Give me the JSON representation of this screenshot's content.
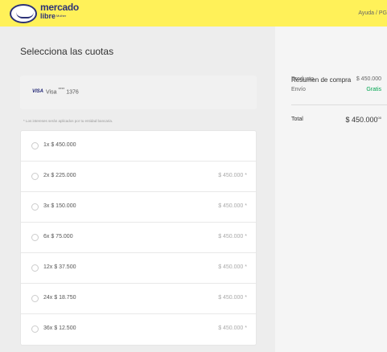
{
  "header": {
    "logo_line1": "mercado",
    "logo_line2": "libre",
    "logo_line3": "Mulher",
    "help_link": "Ayuda / PG"
  },
  "main": {
    "title": "Selecciona las cuotas",
    "card": {
      "brand": "VISA",
      "name": "Visa",
      "mask": "****",
      "last4": "1376"
    },
    "interest_note": "* Los intereses serán aplicados por tu entidad bancaria.",
    "options": [
      {
        "label": "1x $ 450.000",
        "total": ""
      },
      {
        "label": "2x $ 225.000",
        "total": "$ 450.000 *"
      },
      {
        "label": "3x $ 150.000",
        "total": "$ 450.000 *"
      },
      {
        "label": "6x $ 75.000",
        "total": "$ 450.000 *"
      },
      {
        "label": "12x $ 37.500",
        "total": "$ 450.000 *"
      },
      {
        "label": "24x $ 18.750",
        "total": "$ 450.000 *"
      },
      {
        "label": "36x $ 12.500",
        "total": "$ 450.000 *"
      }
    ]
  },
  "summary": {
    "title": "Resumen de compra",
    "product_label": "Producto",
    "product_value": "$ 450.000",
    "shipping_label": "Envío",
    "shipping_value": "Gratis",
    "total_label": "Total",
    "total_value": "$ 450.000",
    "total_cents": "00"
  },
  "colors": {
    "header": "#fff159",
    "brand_blue": "#2d3277",
    "free_green": "#00a650"
  }
}
